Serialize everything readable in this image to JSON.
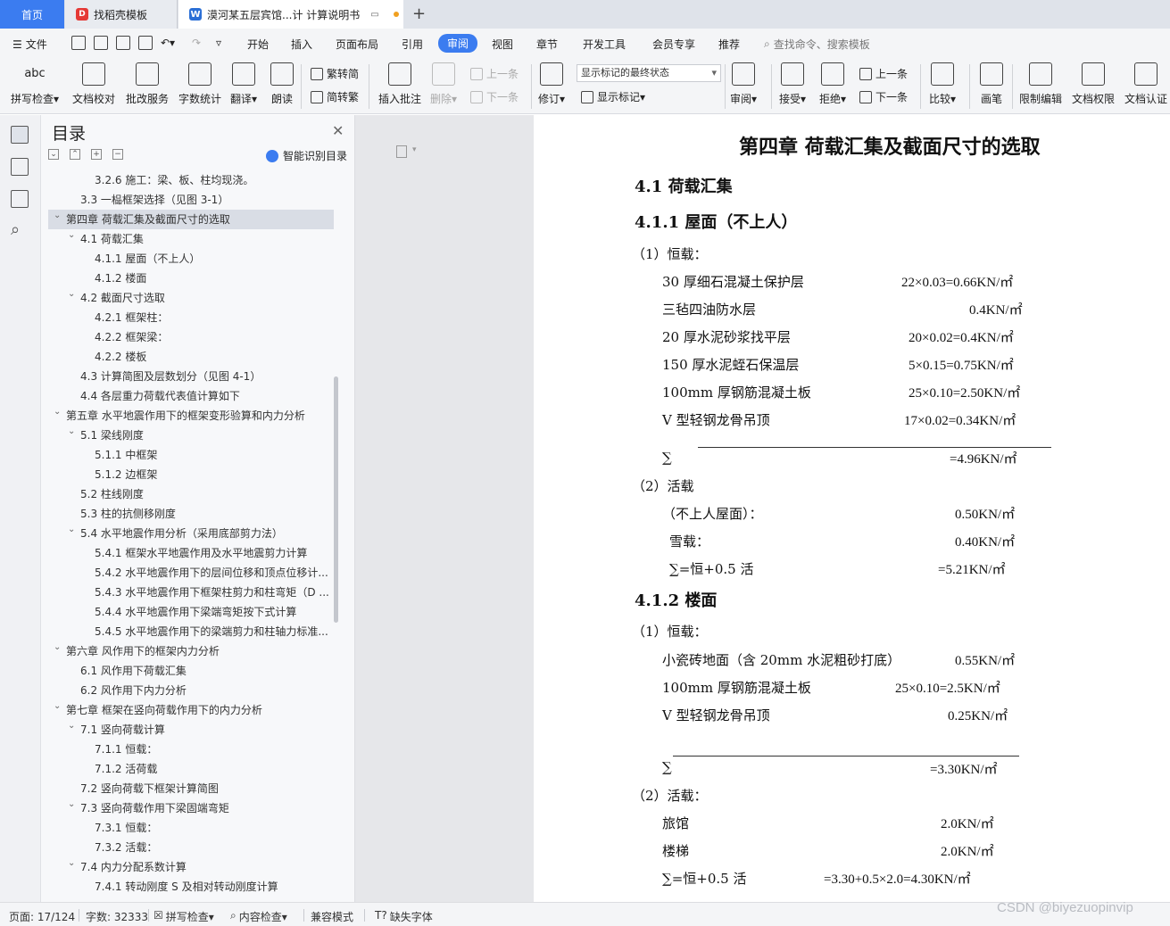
{
  "tabs": [
    {
      "label": "首页"
    },
    {
      "label": "找稻壳模板"
    },
    {
      "label": "漠河某五层宾馆...计 计算说明书"
    }
  ],
  "menu": {
    "file": "文件",
    "items": [
      "开始",
      "插入",
      "页面布局",
      "引用",
      "审阅",
      "视图",
      "章节",
      "开发工具",
      "会员专享",
      "推荐"
    ],
    "active": "审阅",
    "search_placeholder": "查找命令、搜索模板"
  },
  "ribbon": {
    "buttons": [
      "拼写检查▾",
      "文档校对",
      "批改服务",
      "字数统计",
      "翻译▾",
      "朗读"
    ],
    "convert_t2s": "繁转简",
    "convert_s2t": "简转繁",
    "insert_comment": "插入批注",
    "delete": "删除▾",
    "prev_comment": "上一条",
    "next_comment": "下一条",
    "revise": "修订▾",
    "markup_state": "显示标记的最终状态",
    "show_markup": "显示标记▾",
    "review": "审阅▾",
    "accept": "接受▾",
    "reject": "拒绝▾",
    "prev_change": "上一条",
    "next_change": "下一条",
    "compare": "比较▾",
    "pen": "画笔",
    "restrict_edit": "限制编辑",
    "doc_permission": "文档权限",
    "doc_cert": "文档认证"
  },
  "toc": {
    "title": "目录",
    "ai_label": "智能识别目录",
    "items": [
      {
        "text": "3.2.6  施工：梁、板、柱均现浇。",
        "level": 3,
        "arrow": ""
      },
      {
        "text": "3.3 一榀框架选择（见图 3-1）",
        "level": 2,
        "arrow": ""
      },
      {
        "text": "第四章  荷载汇集及截面尺寸的选取",
        "level": 1,
        "arrow": "v",
        "selected": true
      },
      {
        "text": "4.1  荷载汇集",
        "level": 2,
        "arrow": "v"
      },
      {
        "text": "4.1.1  屋面（不上人）",
        "level": 3,
        "arrow": ""
      },
      {
        "text": "4.1.2  楼面",
        "level": 3,
        "arrow": ""
      },
      {
        "text": "4.2 截面尺寸选取",
        "level": 2,
        "arrow": "v"
      },
      {
        "text": "4.2.1  框架柱：",
        "level": 3,
        "arrow": ""
      },
      {
        "text": "4.2.2  框架梁：",
        "level": 3,
        "arrow": ""
      },
      {
        "text": "4.2.2  楼板",
        "level": 3,
        "arrow": ""
      },
      {
        "text": "4.3 计算简图及层数划分（见图 4-1）",
        "level": 2,
        "arrow": ""
      },
      {
        "text": "4.4 各层重力荷载代表值计算如下",
        "level": 2,
        "arrow": ""
      },
      {
        "text": "第五章  水平地震作用下的框架变形验算和内力分析",
        "level": 1,
        "arrow": "v"
      },
      {
        "text": "5.1 梁线刚度",
        "level": 2,
        "arrow": "v"
      },
      {
        "text": "5.1.1  中框架",
        "level": 3,
        "arrow": ""
      },
      {
        "text": "5.1.2  边框架",
        "level": 3,
        "arrow": ""
      },
      {
        "text": "5.2 柱线刚度",
        "level": 2,
        "arrow": ""
      },
      {
        "text": "5.3 柱的抗侧移刚度",
        "level": 2,
        "arrow": ""
      },
      {
        "text": "5.4 水平地震作用分析（采用底部剪力法）",
        "level": 2,
        "arrow": "v"
      },
      {
        "text": "5.4.1 框架水平地震作用及水平地震剪力计算",
        "level": 3,
        "arrow": ""
      },
      {
        "text": "5.4.2 水平地震作用下的层间位移和顶点位移计...",
        "level": 3,
        "arrow": ""
      },
      {
        "text": "5.4.3 水平地震作用下框架柱剪力和柱弯矩（D ...",
        "level": 3,
        "arrow": ""
      },
      {
        "text": "5.4.4    水平地震作用下梁端弯矩按下式计算",
        "level": 3,
        "arrow": ""
      },
      {
        "text": "5.4.5 水平地震作用下的梁端剪力和柱轴力标准...",
        "level": 3,
        "arrow": ""
      },
      {
        "text": "第六章  风作用下的框架内力分析",
        "level": 1,
        "arrow": "v"
      },
      {
        "text": "6.1    风作用下荷载汇集",
        "level": 2,
        "arrow": ""
      },
      {
        "text": "6.2 风作用下内力分析",
        "level": 2,
        "arrow": ""
      },
      {
        "text": "第七章  框架在竖向荷载作用下的内力分析",
        "level": 1,
        "arrow": "v"
      },
      {
        "text": "7.1 竖向荷载计算",
        "level": 2,
        "arrow": "v"
      },
      {
        "text": "7.1.1 恒载：",
        "level": 3,
        "arrow": ""
      },
      {
        "text": "7.1.2 活荷载",
        "level": 3,
        "arrow": ""
      },
      {
        "text": "7.2 竖向荷载下框架计算简图",
        "level": 2,
        "arrow": ""
      },
      {
        "text": "7.3 竖向荷载作用下梁固端弯矩",
        "level": 2,
        "arrow": "v"
      },
      {
        "text": "7.3.1 恒载：",
        "level": 3,
        "arrow": ""
      },
      {
        "text": "7.3.2 活载：",
        "level": 3,
        "arrow": ""
      },
      {
        "text": "7.4 内力分配系数计算",
        "level": 2,
        "arrow": "v"
      },
      {
        "text": "7.4.1 转动刚度 S 及相对转动刚度计算",
        "level": 3,
        "arrow": ""
      }
    ]
  },
  "doc": {
    "chapter": "第四章  荷载汇集及截面尺寸的选取",
    "s41": "4.1  荷载汇集",
    "s411": "4.1.1  屋面（不上人）",
    "dead1": "（1）恒载：",
    "roof": [
      {
        "name": "30 厚细石混凝土保护层",
        "value": "22×0.03=0.66KN/㎡"
      },
      {
        "name": "三毡四油防水层",
        "value": "0.4KN/㎡"
      },
      {
        "name": "20 厚水泥砂浆找平层",
        "value": "20×0.02=0.4KN/㎡"
      },
      {
        "name": "150 厚水泥蛭石保温层",
        "value": "5×0.15=0.75KN/㎡"
      },
      {
        "name": "100mm 厚钢筋混凝土板",
        "value": "25×0.10=2.50KN/㎡"
      },
      {
        "name": "V 型轻钢龙骨吊顶",
        "value": "17×0.02=0.34KN/㎡"
      }
    ],
    "sigma": "∑",
    "roof_sum": "=4.96KN/㎡",
    "live1": "（2）活载",
    "roof_live": [
      {
        "name": "（不上人屋面）：",
        "value": "0.50KN/㎡"
      },
      {
        "name": "雪载：",
        "value": "0.40KN/㎡"
      },
      {
        "name": "∑=恒+0.5 活",
        "value": "=5.21KN/㎡"
      }
    ],
    "s412": "4.1.2  楼面",
    "dead2": "（1）恒载：",
    "floor": [
      {
        "name": "小瓷砖地面（含 20mm 水泥粗砂打底）",
        "value": "0.55KN/㎡"
      },
      {
        "name": "100mm 厚钢筋混凝土板",
        "value": "25×0.10=2.5KN/㎡"
      },
      {
        "name": "V 型轻钢龙骨吊顶",
        "value": "0.25KN/㎡"
      }
    ],
    "floor_sum": "=3.30KN/㎡",
    "live2": "（2）活载：",
    "floor_live": [
      {
        "name": "旅馆",
        "value": "2.0KN/㎡"
      },
      {
        "name": "楼梯",
        "value": "2.0KN/㎡"
      },
      {
        "name": "∑=恒+0.5 活",
        "value": "=3.30+0.5×2.0=4.30KN/㎡"
      }
    ]
  },
  "status": {
    "page": "页面: 17/124",
    "words": "字数: 32333",
    "spell": "拼写检查▾",
    "content": "内容检查▾",
    "compat": "兼容模式",
    "missing_font": "缺失字体"
  },
  "watermark": "CSDN @biyezuopinvip"
}
